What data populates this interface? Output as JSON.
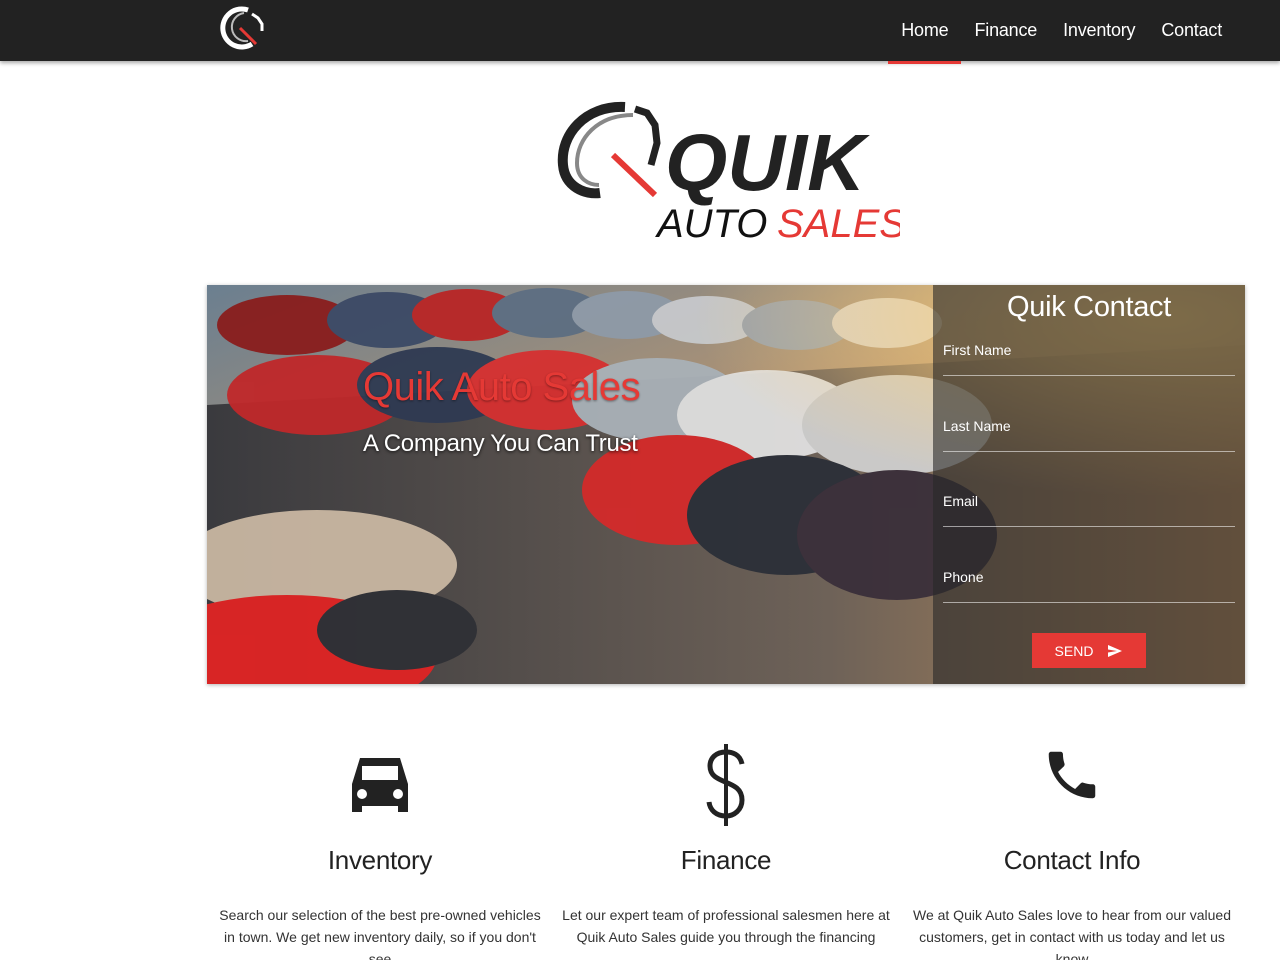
{
  "nav": {
    "items": [
      {
        "label": "Home",
        "active": true
      },
      {
        "label": "Finance",
        "active": false
      },
      {
        "label": "Inventory",
        "active": false
      },
      {
        "label": "Contact",
        "active": false
      }
    ]
  },
  "logo": {
    "word1": "QUIK",
    "word2": "AUTO",
    "word3": "SALES"
  },
  "hero": {
    "title": "Quik Auto Sales",
    "subtitle": "A Company You Can Trust"
  },
  "contact_form": {
    "title": "Quik Contact",
    "first_name_placeholder": "First Name",
    "last_name_placeholder": "Last Name",
    "email_placeholder": "Email",
    "phone_placeholder": "Phone",
    "send_label": "SEND"
  },
  "features": [
    {
      "icon": "car-icon",
      "title": "Inventory",
      "text": "Search our selection of the best pre-owned vehicles in town. We get new inventory daily, so if you don't see"
    },
    {
      "icon": "dollar-icon",
      "title": "Finance",
      "text": "Let our expert team of professional salesmen here at Quik Auto Sales guide you through the financing"
    },
    {
      "icon": "phone-icon",
      "title": "Contact Info",
      "text": "We at Quik Auto Sales love to hear from our valued customers, get in contact with us today and let us know"
    }
  ],
  "colors": {
    "accent": "#e53935",
    "nav_bg": "#222222"
  }
}
